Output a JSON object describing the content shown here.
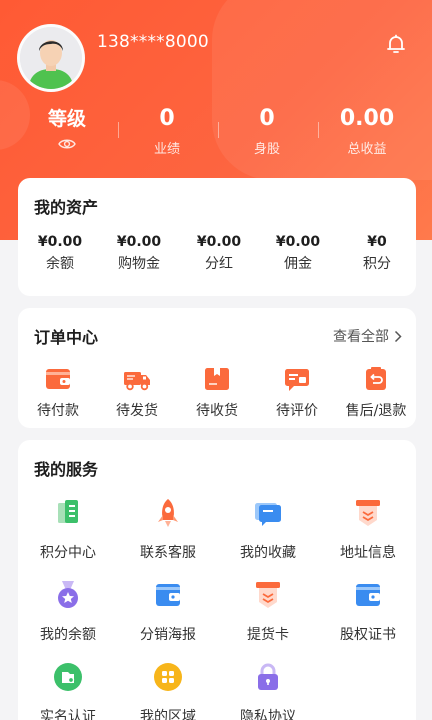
{
  "profile": {
    "phone": "138****8000",
    "level_label": "等级"
  },
  "stats": [
    {
      "value": "0",
      "label": "业绩"
    },
    {
      "value": "0",
      "label": "身股"
    },
    {
      "value": "0.00",
      "label": "总收益"
    }
  ],
  "assets": {
    "title": "我的资产",
    "items": [
      {
        "value": "¥0.00",
        "label": "余额"
      },
      {
        "value": "¥0.00",
        "label": "购物金"
      },
      {
        "value": "¥0.00",
        "label": "分红"
      },
      {
        "value": "¥0.00",
        "label": "佣金"
      },
      {
        "value": "¥0",
        "label": "积分"
      }
    ]
  },
  "orders": {
    "title": "订单中心",
    "see_all": "查看全部",
    "items": [
      {
        "label": "待付款",
        "icon": "wallet-icon"
      },
      {
        "label": "待发货",
        "icon": "truck-icon"
      },
      {
        "label": "待收货",
        "icon": "box-icon"
      },
      {
        "label": "待评价",
        "icon": "comment-icon"
      },
      {
        "label": "售后/退款",
        "icon": "refund-icon"
      }
    ]
  },
  "services": {
    "title": "我的服务",
    "items": [
      {
        "label": "积分中心",
        "icon": "points-icon"
      },
      {
        "label": "联系客服",
        "icon": "rocket-icon"
      },
      {
        "label": "我的收藏",
        "icon": "favorites-icon"
      },
      {
        "label": "地址信息",
        "icon": "address-icon"
      },
      {
        "label": "我的余额",
        "icon": "medal-icon"
      },
      {
        "label": "分销海报",
        "icon": "wallet-icon"
      },
      {
        "label": "提货卡",
        "icon": "pickup-card-icon"
      },
      {
        "label": "股权证书",
        "icon": "certificate-icon"
      },
      {
        "label": "实名认证",
        "icon": "id-verify-icon"
      },
      {
        "label": "我的区域",
        "icon": "region-icon"
      },
      {
        "label": "隐私协议",
        "icon": "lock-icon"
      }
    ]
  },
  "colors": {
    "brand": "#ff5a34",
    "icon_orange": "#fb6a3c",
    "icon_blue": "#3a8cf0",
    "icon_green": "#3cc06a",
    "icon_purple": "#8a6ee8",
    "icon_yellow": "#f7b51a"
  }
}
